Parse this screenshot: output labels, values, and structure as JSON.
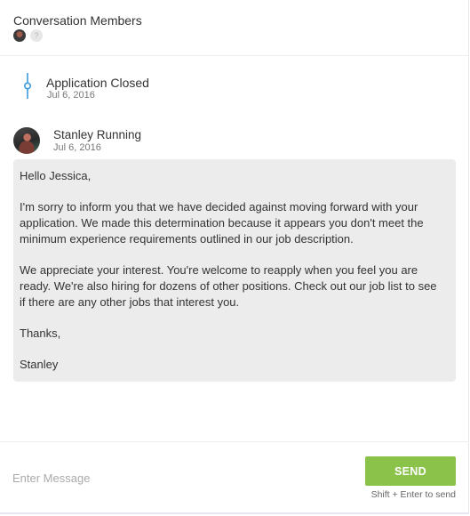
{
  "header": {
    "title": "Conversation Members",
    "members": [
      {
        "icon": "user-photo-avatar"
      },
      {
        "icon": "unknown-user-avatar",
        "glyph": "?"
      }
    ]
  },
  "timeline": {
    "event_title": "Application Closed",
    "event_date": "Jul 6, 2016",
    "icon": "timeline-node-icon",
    "accent_color": "#3b9be0"
  },
  "message": {
    "sender": "Stanley Running",
    "date": "Jul 6, 2016",
    "paragraphs": [
      "Hello Jessica,",
      "I'm sorry to inform you that we have decided against moving forward with your application. We made this determination because it appears you don't meet the minimum experience requirements outlined in our job description.",
      "We appreciate your interest. You're welcome to reapply when you feel you are ready. We're also hiring for dozens of other positions. Check out our job list to see if there are any other jobs that interest you.",
      "Thanks,",
      "Stanley"
    ],
    "bubble_color": "#ececec"
  },
  "composer": {
    "placeholder": "Enter Message",
    "value": "",
    "send_label": "SEND",
    "hint": "Shift + Enter to send",
    "send_color": "#8bc34a"
  }
}
